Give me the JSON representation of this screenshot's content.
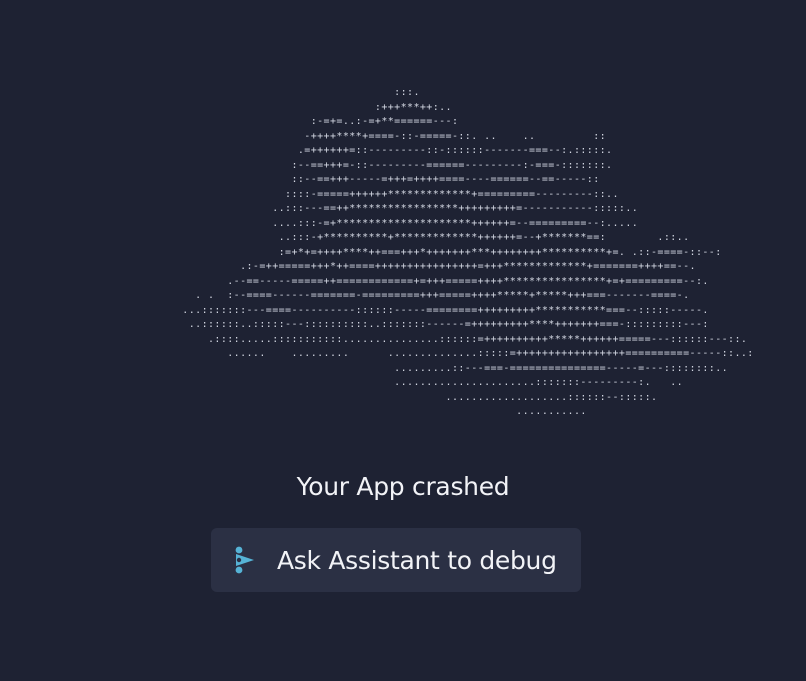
{
  "ascii_art": "                                                :::.\n                                             :+++***++:..\n                                   :-=+=..:-=+**======---:\n                                  -++++****+====-::-=====-::. ..    ..         ::\n                                 .=++++++=::---------::-::::::-------===--:.:::::.\n                                :--==+++=-::---------======---------:-===-:::::::.\n                                ::--==+++-----=+++=++++====----======--==-----::\n                               ::::-=====++++++*************+=========---------::..\n                             ..:::---==++*****************+++++++++=-----------:::::..\n                             ....:::-=+*********************++++++=--=========--:.....\n                              ..:::-+**********+*************++++++=--+*******==:        .::..\n                              :=+*+=++++****++===+++*+++++++***++++++++**********+=. .::-====-::--:\n                        .:-=++=====+++*++====++++++++++++++++=+++*************+=======++++==--.\n                      .--==-----=====++============+=+++=====++++****************+=+=========--:.\n                 . .  :--====------=======-=========+++=====++++*****+*****+++===-------====-.\n               ...:::::::---====----------::::::-----========+++++++++***********===--:::::-----.\n                ..::::::..:::::---::::::::::..:::::::------=+++++++++****+++++++===-:::::::::---:\n                   .::::.....:::::::::::...............::::::=++++++++++*****++++++=====---::::::---::.\n                      ......    .........      ..............:::::=+++++++++++++++++==========-----::..:\n                                                .........::---===-===============-----=---::::::::..\n                                                ......................:::::::---------:.   ..\n                                                        ...................::::::--:::::.\n                                                                   ...........",
  "crash_message": "Your App crashed",
  "debug_button": {
    "label": "Ask Assistant to debug",
    "icon": "assistant-icon"
  },
  "colors": {
    "background": "#1e2233",
    "button_background": "#2b3044",
    "text": "#f2f3f7",
    "ascii": "#d4d8e3",
    "icon_accent": "#56b3d6"
  }
}
